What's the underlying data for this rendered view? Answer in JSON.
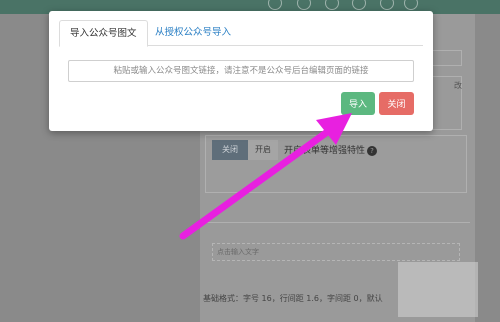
{
  "modal": {
    "tabs": [
      {
        "label": "导入公众号图文",
        "active": true
      },
      {
        "label": "从授权公众号导入",
        "active": false
      }
    ],
    "url_input": {
      "value": "",
      "placeholder": "粘贴或输入公众号图文链接，请注意不是公众号后台编辑页面的链接"
    },
    "buttons": {
      "import_label": "导入",
      "close_label": "关闭"
    }
  },
  "background": {
    "toggle_off_label": "关闭",
    "toggle_on_label": "开启",
    "feature_text": "开启表单等增强特性",
    "help_icon": "question-circle-icon",
    "side_text": "改",
    "text_placeholder": "点击输入文字",
    "footer_text": "基础格式：字号 16，行间距 1.6，字间距 0，默认"
  },
  "colors": {
    "import_button": "#5cb880",
    "close_button": "#e66c66",
    "tab_link": "#2a7fc4",
    "annotation_arrow": "#e820e0",
    "topbar": "#4a7366"
  }
}
